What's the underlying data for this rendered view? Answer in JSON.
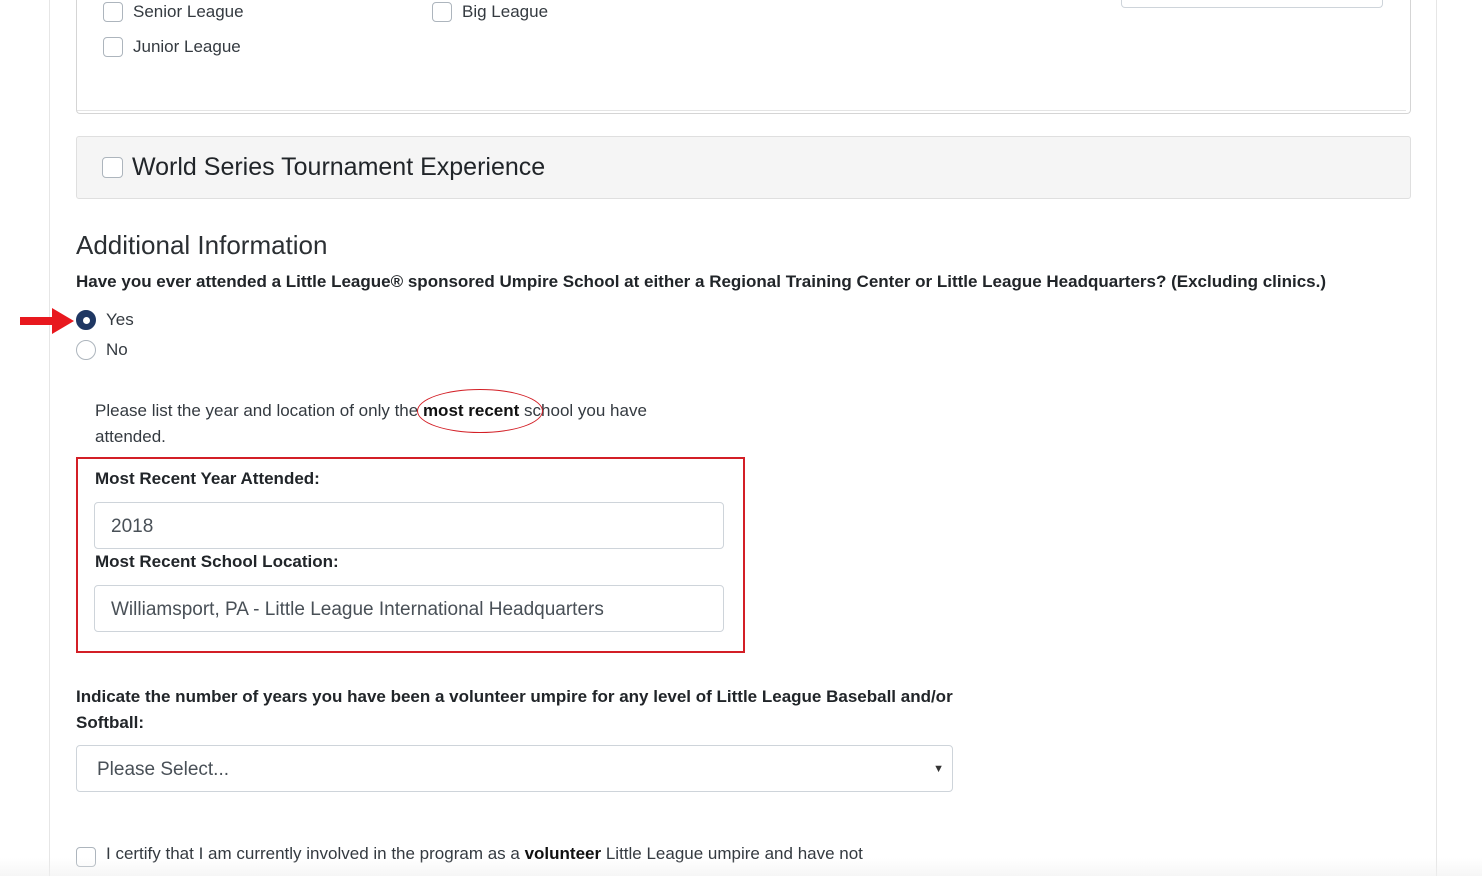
{
  "experience": {
    "levels": [
      {
        "label": "Senior League",
        "checked": false
      },
      {
        "label": "Big League",
        "checked": false
      },
      {
        "label": "Junior League",
        "checked": false
      }
    ]
  },
  "world_series": {
    "label": "World Series Tournament Experience",
    "checked": false
  },
  "additional": {
    "title": "Additional Information",
    "question": "Have you ever attended a Little League® sponsored Umpire School at either a Regional Training Center or Little League Headquarters? (Excluding clinics.)",
    "options": [
      {
        "label": "Yes",
        "selected": true
      },
      {
        "label": "No",
        "selected": false
      }
    ],
    "instruction_pre": "Please list the year and location of only the ",
    "instruction_bold": "most recent",
    "instruction_post": " school you have attended.",
    "year_label": "Most Recent Year Attended:",
    "year_value": "2018",
    "location_label": "Most Recent School Location:",
    "location_value": "Williamsport, PA - Little League International Headquarters"
  },
  "volunteer": {
    "question_pre": "Indicate the number of years you have been a ",
    "question_bold": "volunteer umpire",
    "question_post": " for any level of Little League Baseball and/or Softball:",
    "select_value": "Please Select..."
  },
  "certify": {
    "text_pre": "I certify that I am currently involved in the program as a ",
    "text_bold": "volunteer",
    "text_post": " Little League umpire and have not",
    "checked": false
  },
  "colors": {
    "accent": "#1f3763",
    "annotation": "#d31f26",
    "card_bg": "#f5f5f5"
  }
}
